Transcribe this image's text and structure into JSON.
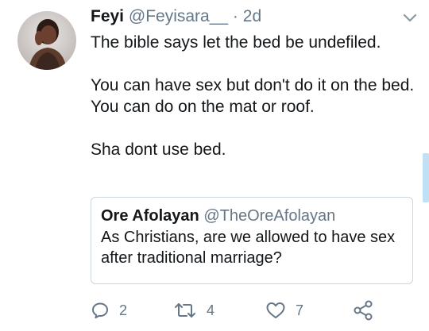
{
  "tweet": {
    "author_name": "Feyi",
    "author_handle": "@Feyisara__",
    "separator": "·",
    "time": "2d",
    "lines": [
      "The bible says let the bed be undefiled.",
      "",
      "You can have sex but don't do it on the bed.",
      "You can do on the mat or roof.",
      "",
      "Sha dont use bed."
    ]
  },
  "quoted_tweet": {
    "author_name": "Ore Afolayan",
    "author_handle": "@TheOreAfolayan",
    "text": "As Christians, are we allowed to have sex after traditional marriage?"
  },
  "actions": {
    "reply_count": "2",
    "retweet_count": "4",
    "like_count": "7"
  },
  "icons": {
    "reply": "reply-icon",
    "retweet": "retweet-icon",
    "like": "heart-icon",
    "share": "share-icon",
    "menu": "chevron-down-icon"
  },
  "colors": {
    "text_primary": "#14171a",
    "text_secondary": "#657786",
    "border": "#ccd6dd",
    "scroll_accent": "#bfe0f5"
  }
}
